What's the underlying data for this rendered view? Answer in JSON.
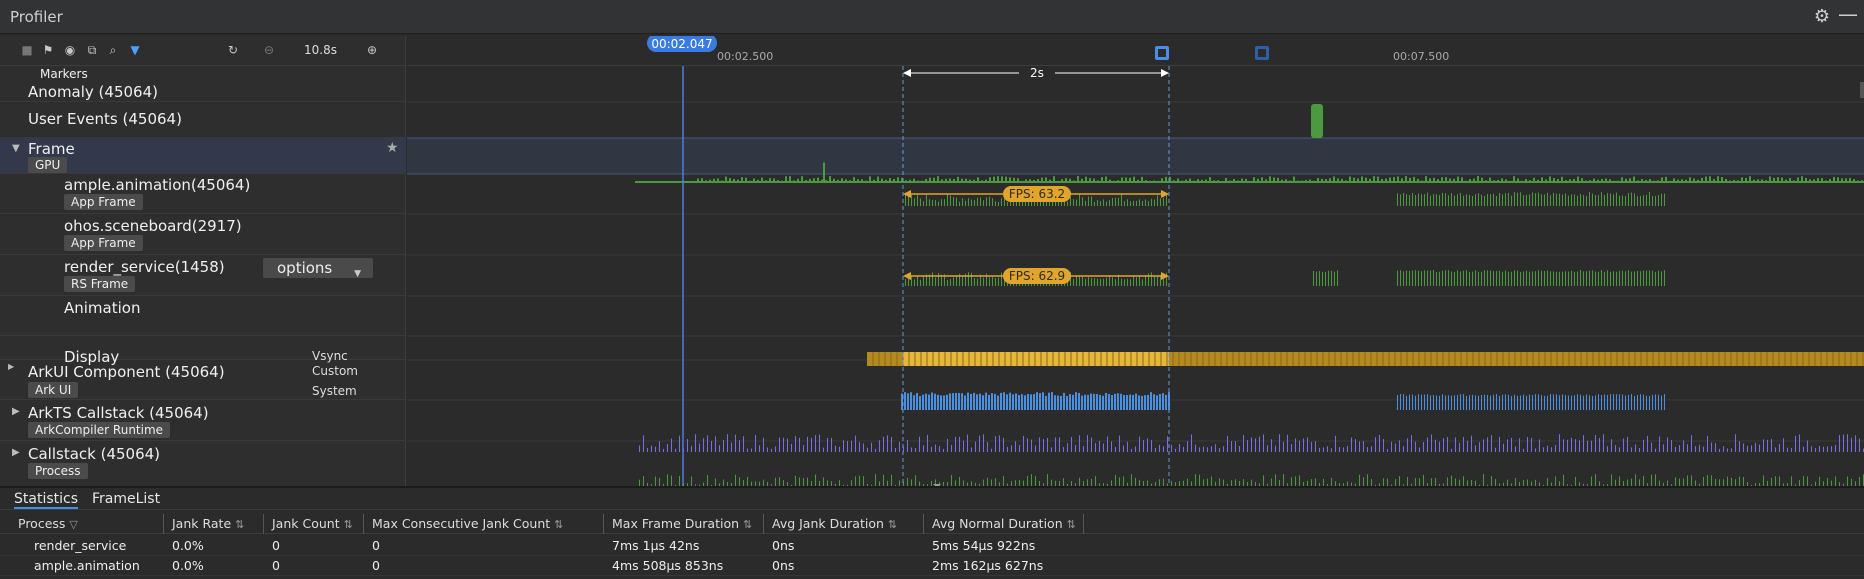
{
  "window": {
    "title": "Profiler"
  },
  "toolbar": {
    "duration": "10.8s"
  },
  "ruler": {
    "cursor_time": "00:02.047",
    "tick_a": "00:02.500",
    "tick_b": "00:07.500",
    "selection_span": "2s"
  },
  "rows": {
    "markers": "Markers",
    "anomaly": "Anomaly (45064)",
    "user_events": "User Events (45064)",
    "frame": "Frame",
    "frame_chip": "GPU",
    "ample": "ample.animation(45064)",
    "ample_chip": "App Frame",
    "scene": "ohos.sceneboard(2917)",
    "scene_chip": "App Frame",
    "render": "render_service(1458)",
    "render_chip": "RS Frame",
    "options": "options",
    "animation": "Animation",
    "display": "Display",
    "vsync": "Vsync",
    "arkui": "ArkUI Component (45064)",
    "arkui_chip": "Ark UI",
    "custom": "Custom",
    "system": "System",
    "arkts": "ArkTS Callstack (45064)",
    "arkts_chip": "ArkCompiler Runtime",
    "callstack": "Callstack (45064)",
    "callstack_chip": "Process"
  },
  "fps": {
    "ample": "FPS: 63.2",
    "render": "FPS: 62.9"
  },
  "colors": {
    "accent": "#4a90e2",
    "gpu": "#4c9a3f",
    "fps": "#e0a52a",
    "vsync": "#e0b23a",
    "arkui": "#4a8fe0",
    "ark": "#7a6ee8"
  },
  "bottom": {
    "tabs": [
      "Statistics",
      "FrameList"
    ],
    "columns": [
      "Process",
      "Jank Rate",
      "Jank Count",
      "Max Consecutive Jank Count",
      "Max Frame Duration",
      "Avg Jank Duration",
      "Avg Normal Duration"
    ],
    "rows": [
      [
        "render_service",
        "0.0%",
        "0",
        "0",
        "7ms 1µs 42ns",
        "0ns",
        "5ms 54µs 922ns"
      ],
      [
        "ample.animation",
        "0.0%",
        "0",
        "0",
        "4ms 508µs 853ns",
        "0ns",
        "2ms 162µs 627ns"
      ]
    ]
  }
}
